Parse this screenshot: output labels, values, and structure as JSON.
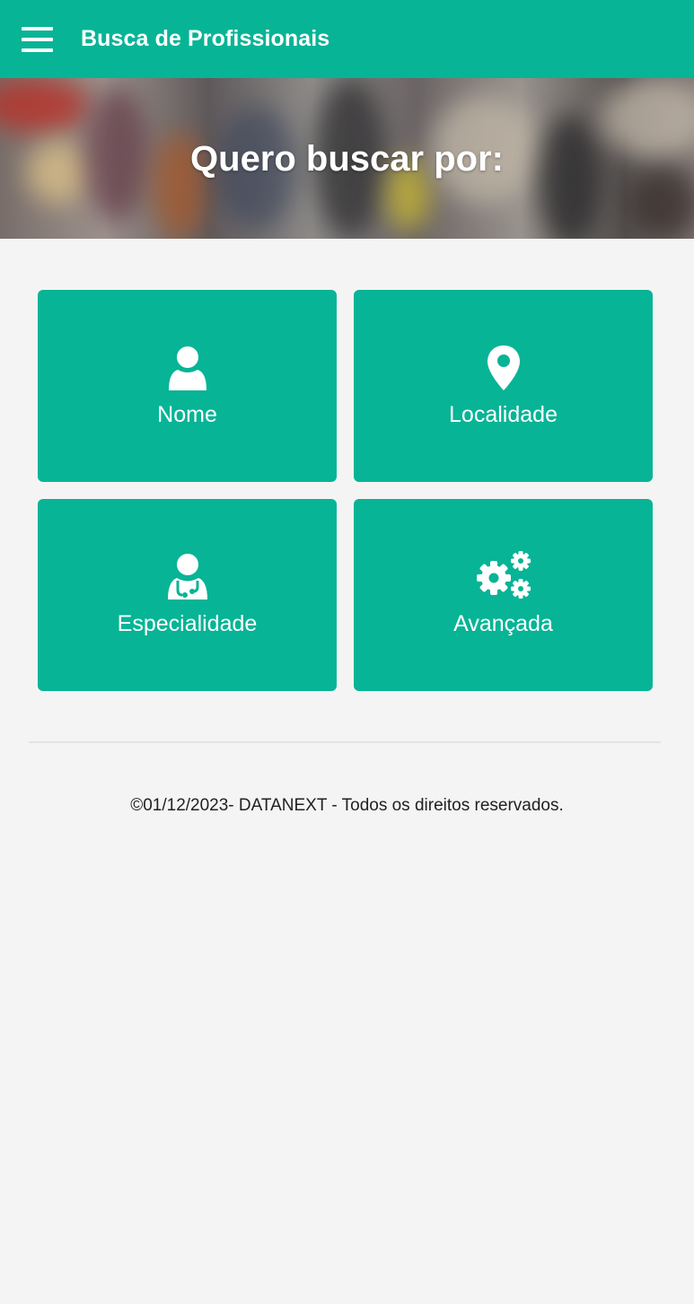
{
  "header": {
    "title": "Busca de Profissionais",
    "menu_icon": "hamburger-menu-icon",
    "background": "#07b496"
  },
  "hero": {
    "title": "Quero buscar por:"
  },
  "options": [
    {
      "label": "Nome",
      "icon": "user-icon"
    },
    {
      "label": "Localidade",
      "icon": "map-pin-icon"
    },
    {
      "label": "Especialidade",
      "icon": "doctor-stethoscope-icon"
    },
    {
      "label": "Avançada",
      "icon": "gears-icon"
    }
  ],
  "footer": {
    "text": "©01/12/2023- DATANEXT - Todos os direitos reservados."
  },
  "colors": {
    "accent": "#07b496",
    "background": "#f4f4f4",
    "text": "#212121"
  }
}
